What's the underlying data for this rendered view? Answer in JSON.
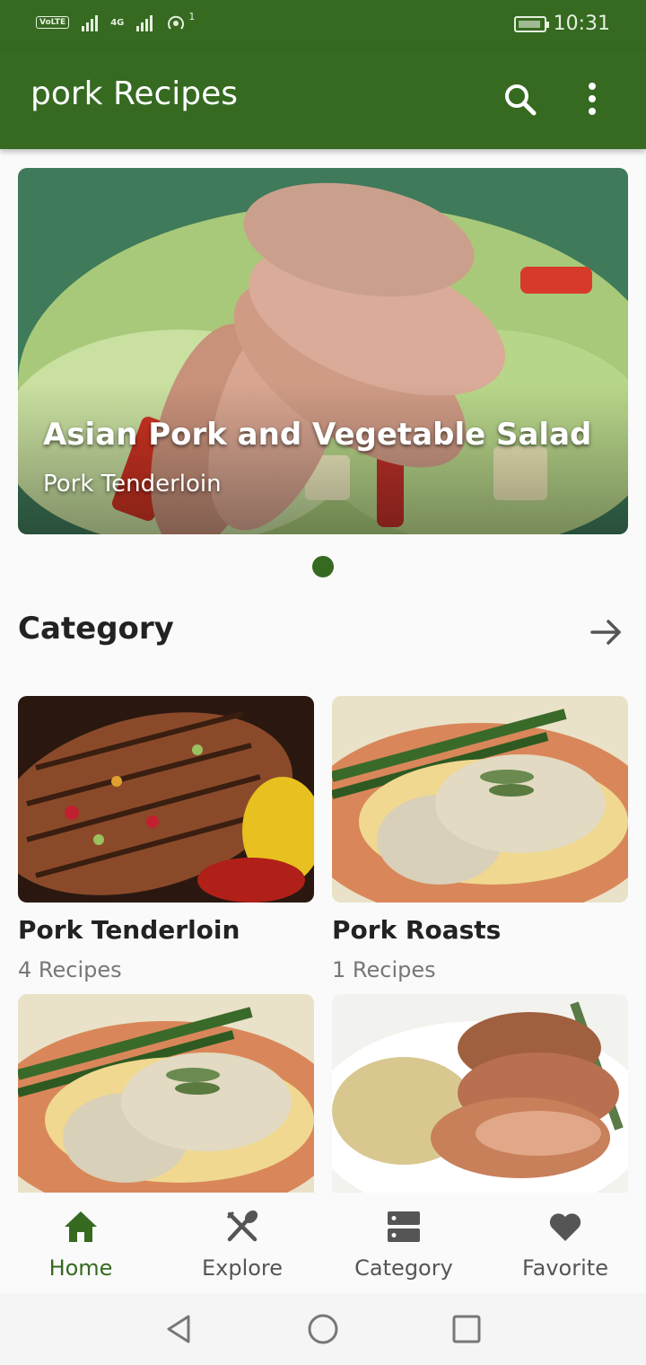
{
  "status_bar": {
    "volte": "VoLTE",
    "network": "4G",
    "hotspot_count": "1",
    "time": "10:31"
  },
  "app_bar": {
    "title": "pork Recipes",
    "search_icon": "search-icon",
    "menu_icon": "more-vert-icon"
  },
  "hero": {
    "title": "Asian Pork and Vegetable Salad",
    "subtitle": "Pork Tenderloin"
  },
  "category": {
    "heading": "Category",
    "items": [
      {
        "name": "Pork Tenderloin",
        "count": "4 Recipes"
      },
      {
        "name": "Pork Roasts",
        "count": "1 Recipes"
      },
      {
        "name": "",
        "count": ""
      },
      {
        "name": "",
        "count": ""
      }
    ]
  },
  "bottom_nav": {
    "items": [
      {
        "label": "Home",
        "icon": "home-icon",
        "active": true
      },
      {
        "label": "Explore",
        "icon": "fork-knife-icon",
        "active": false
      },
      {
        "label": "Category",
        "icon": "category-icon",
        "active": false
      },
      {
        "label": "Favorite",
        "icon": "heart-icon",
        "active": false
      }
    ]
  },
  "colors": {
    "primary": "#356a20",
    "background": "#fafafa"
  }
}
